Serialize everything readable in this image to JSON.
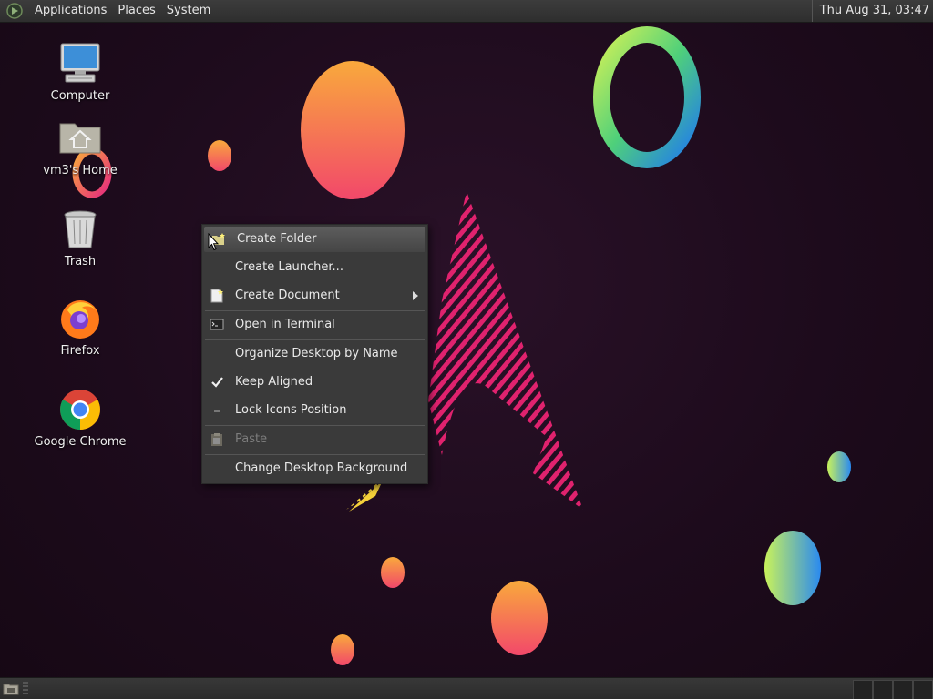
{
  "top_panel": {
    "menus": [
      "Applications",
      "Places",
      "System"
    ],
    "clock": "Thu Aug 31, 03:47"
  },
  "desktop_icons": [
    {
      "label": "Computer",
      "icon": "computer-icon"
    },
    {
      "label": "vm3's Home",
      "icon": "home-folder-icon"
    },
    {
      "label": "Trash",
      "icon": "trash-icon"
    },
    {
      "label": "Firefox",
      "icon": "firefox-icon"
    },
    {
      "label": "Google Chrome",
      "icon": "chrome-icon"
    }
  ],
  "context_menu": {
    "items": [
      {
        "label": "Create Folder",
        "icon": "new-folder-icon",
        "highlighted": true
      },
      {
        "label": "Create Launcher...",
        "icon": ""
      },
      {
        "label": "Create Document",
        "icon": "new-document-icon",
        "submenu": true
      },
      {
        "label": "Open in Terminal",
        "icon": "terminal-icon"
      },
      {
        "label": "Organize Desktop by Name",
        "icon": ""
      },
      {
        "label": "Keep Aligned",
        "icon": "checkmark-icon",
        "checked": true
      },
      {
        "label": "Lock Icons Position",
        "icon": "unchecked-icon"
      },
      {
        "label": "Paste",
        "icon": "paste-icon",
        "disabled": true
      },
      {
        "label": "Change Desktop Background",
        "icon": ""
      }
    ]
  },
  "colors": {
    "panel": "#333333",
    "menu_bg": "#3a3a3a",
    "highlight": "#555555",
    "wallpaper_bg": "#1e0c1d",
    "accent_pink": "#e0226e",
    "accent_orange": "#f7a43a"
  }
}
